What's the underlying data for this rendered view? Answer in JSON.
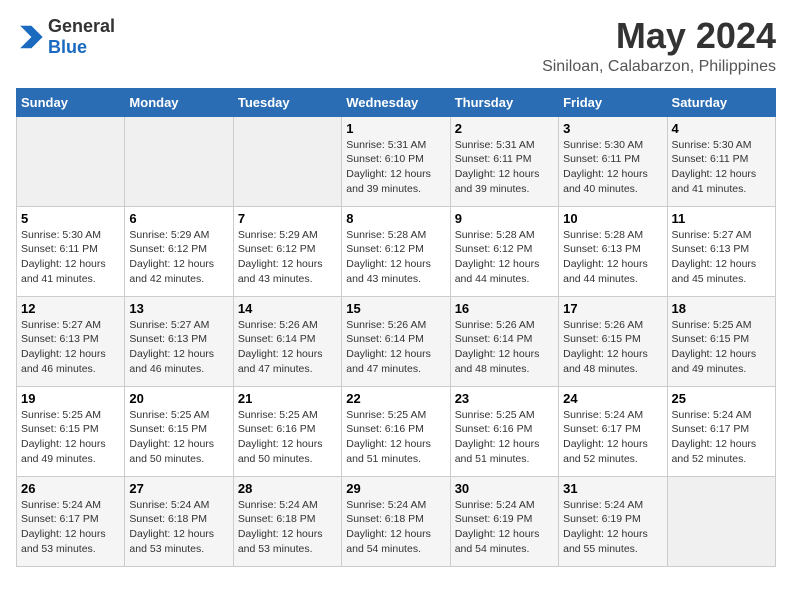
{
  "header": {
    "logo_general": "General",
    "logo_blue": "Blue",
    "title": "May 2024",
    "subtitle": "Siniloan, Calabarzon, Philippines"
  },
  "weekdays": [
    "Sunday",
    "Monday",
    "Tuesday",
    "Wednesday",
    "Thursday",
    "Friday",
    "Saturday"
  ],
  "weeks": [
    {
      "days": [
        {
          "num": "",
          "info": ""
        },
        {
          "num": "",
          "info": ""
        },
        {
          "num": "",
          "info": ""
        },
        {
          "num": "1",
          "info": "Sunrise: 5:31 AM\nSunset: 6:10 PM\nDaylight: 12 hours\nand 39 minutes."
        },
        {
          "num": "2",
          "info": "Sunrise: 5:31 AM\nSunset: 6:11 PM\nDaylight: 12 hours\nand 39 minutes."
        },
        {
          "num": "3",
          "info": "Sunrise: 5:30 AM\nSunset: 6:11 PM\nDaylight: 12 hours\nand 40 minutes."
        },
        {
          "num": "4",
          "info": "Sunrise: 5:30 AM\nSunset: 6:11 PM\nDaylight: 12 hours\nand 41 minutes."
        }
      ]
    },
    {
      "days": [
        {
          "num": "5",
          "info": "Sunrise: 5:30 AM\nSunset: 6:11 PM\nDaylight: 12 hours\nand 41 minutes."
        },
        {
          "num": "6",
          "info": "Sunrise: 5:29 AM\nSunset: 6:12 PM\nDaylight: 12 hours\nand 42 minutes."
        },
        {
          "num": "7",
          "info": "Sunrise: 5:29 AM\nSunset: 6:12 PM\nDaylight: 12 hours\nand 43 minutes."
        },
        {
          "num": "8",
          "info": "Sunrise: 5:28 AM\nSunset: 6:12 PM\nDaylight: 12 hours\nand 43 minutes."
        },
        {
          "num": "9",
          "info": "Sunrise: 5:28 AM\nSunset: 6:12 PM\nDaylight: 12 hours\nand 44 minutes."
        },
        {
          "num": "10",
          "info": "Sunrise: 5:28 AM\nSunset: 6:13 PM\nDaylight: 12 hours\nand 44 minutes."
        },
        {
          "num": "11",
          "info": "Sunrise: 5:27 AM\nSunset: 6:13 PM\nDaylight: 12 hours\nand 45 minutes."
        }
      ]
    },
    {
      "days": [
        {
          "num": "12",
          "info": "Sunrise: 5:27 AM\nSunset: 6:13 PM\nDaylight: 12 hours\nand 46 minutes."
        },
        {
          "num": "13",
          "info": "Sunrise: 5:27 AM\nSunset: 6:13 PM\nDaylight: 12 hours\nand 46 minutes."
        },
        {
          "num": "14",
          "info": "Sunrise: 5:26 AM\nSunset: 6:14 PM\nDaylight: 12 hours\nand 47 minutes."
        },
        {
          "num": "15",
          "info": "Sunrise: 5:26 AM\nSunset: 6:14 PM\nDaylight: 12 hours\nand 47 minutes."
        },
        {
          "num": "16",
          "info": "Sunrise: 5:26 AM\nSunset: 6:14 PM\nDaylight: 12 hours\nand 48 minutes."
        },
        {
          "num": "17",
          "info": "Sunrise: 5:26 AM\nSunset: 6:15 PM\nDaylight: 12 hours\nand 48 minutes."
        },
        {
          "num": "18",
          "info": "Sunrise: 5:25 AM\nSunset: 6:15 PM\nDaylight: 12 hours\nand 49 minutes."
        }
      ]
    },
    {
      "days": [
        {
          "num": "19",
          "info": "Sunrise: 5:25 AM\nSunset: 6:15 PM\nDaylight: 12 hours\nand 49 minutes."
        },
        {
          "num": "20",
          "info": "Sunrise: 5:25 AM\nSunset: 6:15 PM\nDaylight: 12 hours\nand 50 minutes."
        },
        {
          "num": "21",
          "info": "Sunrise: 5:25 AM\nSunset: 6:16 PM\nDaylight: 12 hours\nand 50 minutes."
        },
        {
          "num": "22",
          "info": "Sunrise: 5:25 AM\nSunset: 6:16 PM\nDaylight: 12 hours\nand 51 minutes."
        },
        {
          "num": "23",
          "info": "Sunrise: 5:25 AM\nSunset: 6:16 PM\nDaylight: 12 hours\nand 51 minutes."
        },
        {
          "num": "24",
          "info": "Sunrise: 5:24 AM\nSunset: 6:17 PM\nDaylight: 12 hours\nand 52 minutes."
        },
        {
          "num": "25",
          "info": "Sunrise: 5:24 AM\nSunset: 6:17 PM\nDaylight: 12 hours\nand 52 minutes."
        }
      ]
    },
    {
      "days": [
        {
          "num": "26",
          "info": "Sunrise: 5:24 AM\nSunset: 6:17 PM\nDaylight: 12 hours\nand 53 minutes."
        },
        {
          "num": "27",
          "info": "Sunrise: 5:24 AM\nSunset: 6:18 PM\nDaylight: 12 hours\nand 53 minutes."
        },
        {
          "num": "28",
          "info": "Sunrise: 5:24 AM\nSunset: 6:18 PM\nDaylight: 12 hours\nand 53 minutes."
        },
        {
          "num": "29",
          "info": "Sunrise: 5:24 AM\nSunset: 6:18 PM\nDaylight: 12 hours\nand 54 minutes."
        },
        {
          "num": "30",
          "info": "Sunrise: 5:24 AM\nSunset: 6:19 PM\nDaylight: 12 hours\nand 54 minutes."
        },
        {
          "num": "31",
          "info": "Sunrise: 5:24 AM\nSunset: 6:19 PM\nDaylight: 12 hours\nand 55 minutes."
        },
        {
          "num": "",
          "info": ""
        }
      ]
    }
  ]
}
